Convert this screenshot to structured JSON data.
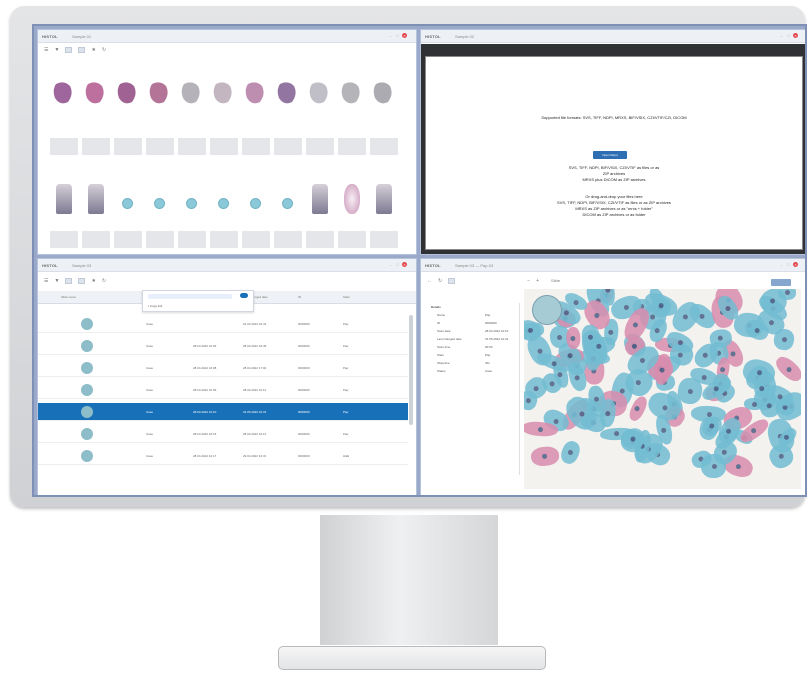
{
  "app": {
    "logo": "HISTOL",
    "panes": [
      {
        "title": "Sample 01"
      },
      {
        "title": "Sample 02"
      },
      {
        "title": "Sample 03"
      },
      {
        "title": "Sample 03 — Pap-03"
      }
    ]
  },
  "upload": {
    "supported_formats": "Supported file formats: SVS, TIFF, NDPI, MRXS, BIF/VSIX, CZI/VTIF/CZI, DICOM",
    "button": "Open file(s)",
    "rules": [
      "SVS, TIFF, NDPI, BIF/VSIX, CZI/VTIF as files or as",
      "ZIP archives",
      "MRXS plus DICOM as ZIP archives",
      "Or drag-and-drop your files here",
      "SVS, TIFF, NDPI, BIF/VSIX, CZI/VTIF as files or as ZIP archives",
      "MRXS as ZIP archives or as \"mrxs + folder\"",
      "DICOM as ZIP archives or as folder"
    ]
  },
  "table": {
    "columns": [
      "Slide name",
      "Type",
      "Scan date",
      "Last changed date",
      "ID",
      "Stain"
    ],
    "menu_item": "Copy link",
    "rows": [
      {
        "type": "Case",
        "scan": "",
        "changed": "01.04.2022 10:41",
        "id": "0000000",
        "stain": "Pap"
      },
      {
        "type": "Case",
        "scan": "28.04.2022 10:03",
        "changed": "28.04.2022 10:49",
        "id": "0000000",
        "stain": "Pap"
      },
      {
        "type": "Case",
        "scan": "28.04.2022 10:08",
        "changed": "28.04.2022 17:02",
        "id": "0000000",
        "stain": "Pap"
      },
      {
        "type": "Case",
        "scan": "28.04.2022 10:09",
        "changed": "28.04.2022 10:11",
        "id": "0000000",
        "stain": "Pap"
      },
      {
        "type": "Case",
        "scan": "28.04.2022 10:10",
        "changed": "31.05.2022 10:31",
        "id": "0000000",
        "stain": "Pap"
      },
      {
        "type": "Case",
        "scan": "28.04.2022 10:15",
        "changed": "28.04.2022 10:11",
        "id": "0000000",
        "stain": "Pap"
      },
      {
        "type": "Case",
        "scan": "28.04.2022 10:17",
        "changed": "29.04.2022 10:31",
        "id": "0000000",
        "stain": "H&E"
      }
    ]
  },
  "metadata": {
    "header": "Details",
    "fields": [
      [
        "Name",
        "Pap"
      ],
      [
        "ID",
        "0000000"
      ],
      [
        "Scan date",
        "28.04.2022 10:10"
      ],
      [
        "Last changed date",
        "31.05.2022 10:31"
      ],
      [
        "Scan time",
        "00:00"
      ],
      [
        "Stain",
        "Pap"
      ],
      [
        "Objective",
        "40x"
      ],
      [
        "Status",
        "Case"
      ]
    ],
    "tab": "Slide"
  }
}
